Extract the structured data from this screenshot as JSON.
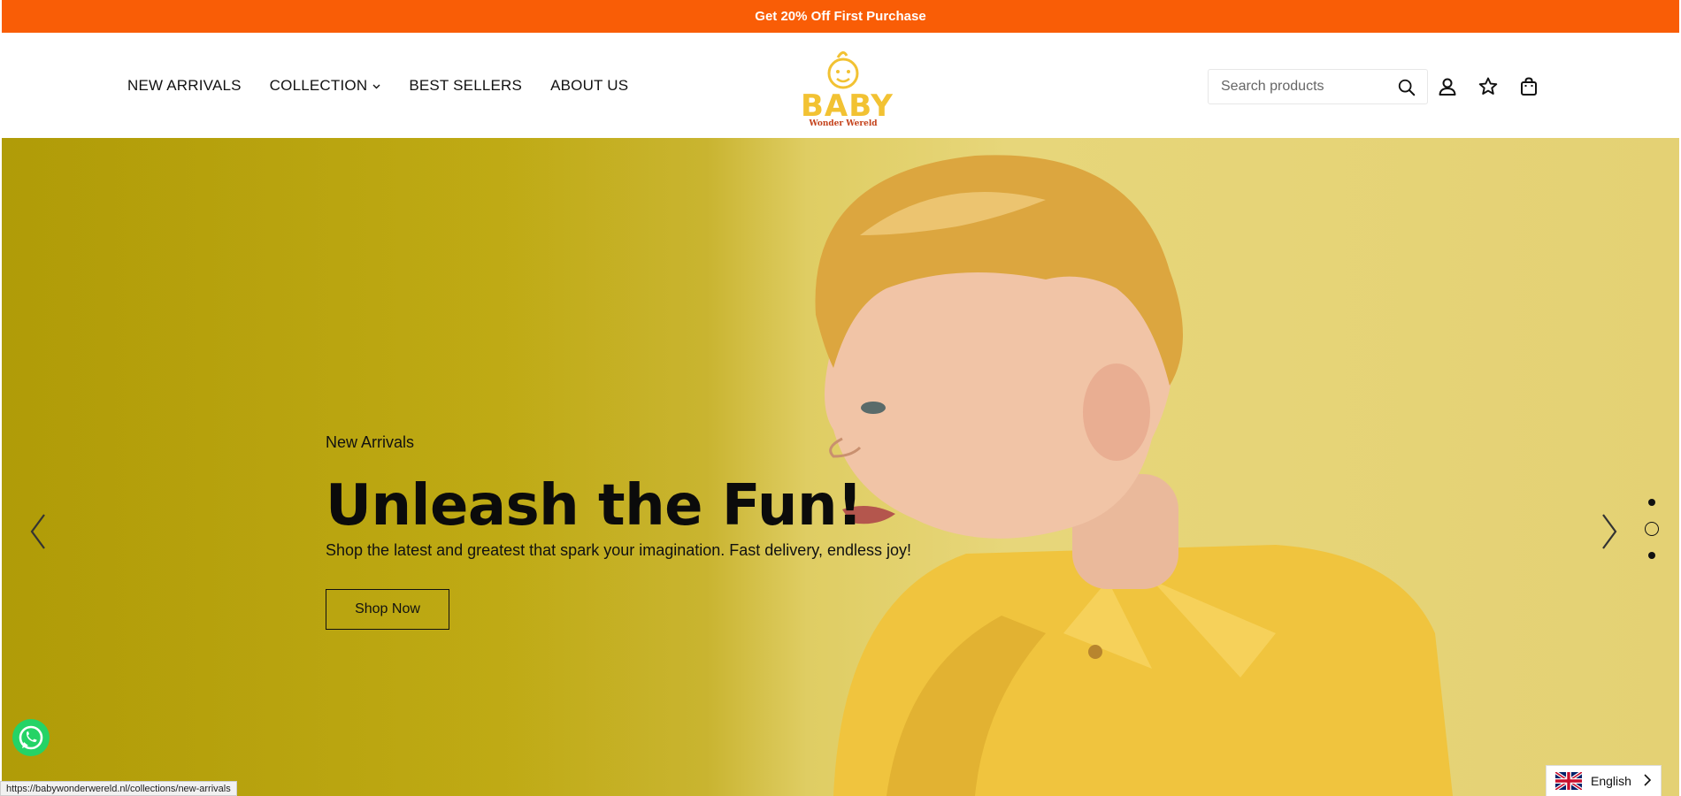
{
  "announcement": {
    "text": "Get 20% Off First Purchase",
    "bg_color": "#f95d06"
  },
  "nav": {
    "items": [
      {
        "label": "NEW ARRIVALS"
      },
      {
        "label": "COLLECTION",
        "has_dropdown": true
      },
      {
        "label": "BEST SELLERS"
      },
      {
        "label": "ABOUT US"
      }
    ]
  },
  "logo": {
    "main": "BABY",
    "sub": "Wonder Wereld"
  },
  "search": {
    "placeholder": "Search products",
    "value": ""
  },
  "header_icons": [
    "search-icon",
    "account-icon",
    "wishlist-star-icon",
    "cart-bag-icon"
  ],
  "hero": {
    "subtitle": "New Arrivals",
    "title": "Unleash the Fun!",
    "description": "Shop the latest and greatest that spark your imagination. Fast delivery, endless joy!",
    "button_label": "Shop Now",
    "slides_count": 3,
    "active_slide": 2
  },
  "status_bar": {
    "url": "https://babywonderwereld.nl/collections/new-arrivals"
  },
  "language": {
    "label": "English",
    "flag": "uk-flag-icon"
  },
  "colors": {
    "accent": "#f95d06",
    "logo_yellow": "#f2c233",
    "hero_yellow": "#e4d174",
    "whatsapp": "#25d366"
  }
}
